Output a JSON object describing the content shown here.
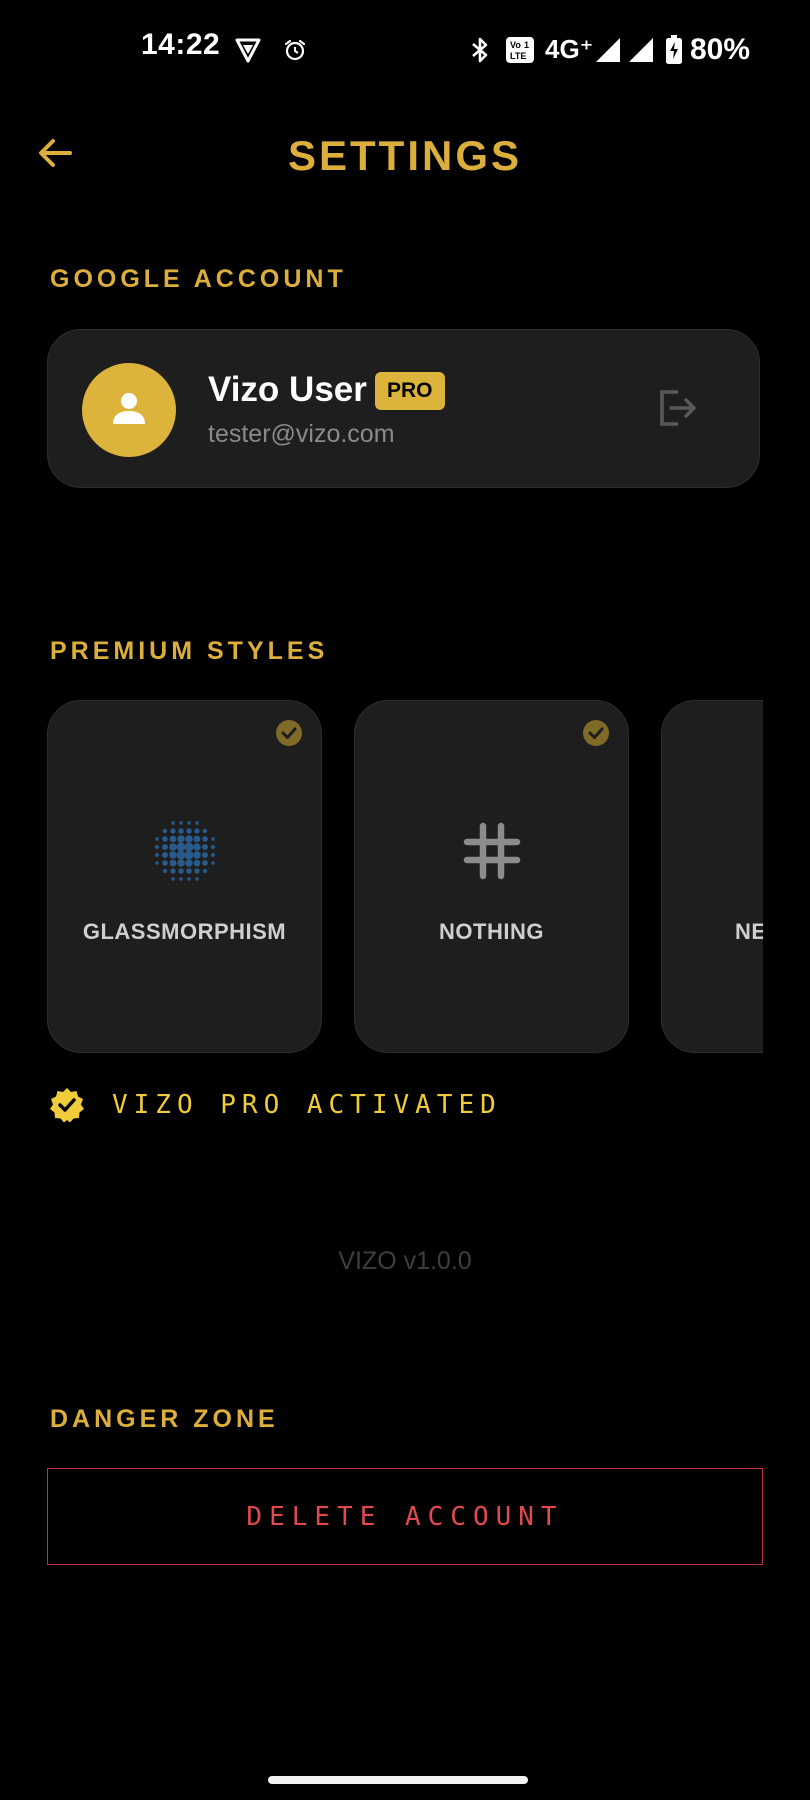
{
  "status_bar": {
    "time": "14:22",
    "network": "4G⁺",
    "battery": "80%",
    "icons": [
      "vpn-shield-icon",
      "alarm-icon",
      "bluetooth-icon",
      "volte-icon",
      "signal-icon",
      "signal-icon",
      "battery-charging-icon"
    ]
  },
  "header": {
    "title": "SETTINGS",
    "back_icon": "arrow-left-icon"
  },
  "account": {
    "section_label": "GOOGLE ACCOUNT",
    "name": "Vizo User",
    "badge": "PRO",
    "email": "tester@vizo.com",
    "avatar_icon": "person-icon",
    "logout_icon": "logout-icon"
  },
  "styles": {
    "section_label": "PREMIUM STYLES",
    "items": [
      {
        "label": "GLASSMORPHISM",
        "icon": "dot-grid-icon",
        "selected": true
      },
      {
        "label": "NOTHING",
        "icon": "hash-icon",
        "selected": true
      },
      {
        "label": "NE",
        "icon": "",
        "selected": false
      }
    ]
  },
  "pro_status": {
    "text": "VIZO PRO ACTIVATED",
    "icon": "verified-badge-icon"
  },
  "version": "VIZO v1.0.0",
  "danger": {
    "section_label": "DANGER ZONE",
    "delete_label": "DELETE ACCOUNT"
  },
  "colors": {
    "accent": "#dcae3c",
    "badge": "#dcb43c",
    "pro_text": "#f0cc3a",
    "danger": "#e0494f",
    "card": "#1e1e1e",
    "background": "#000000"
  }
}
